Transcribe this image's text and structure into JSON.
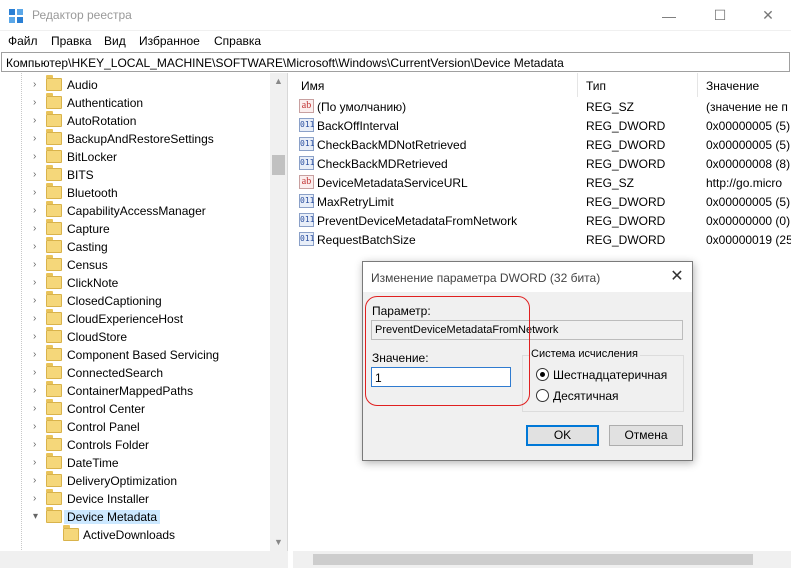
{
  "window": {
    "title": "Редактор реестра",
    "minimize": "—",
    "maximize": "☐",
    "close": "✕"
  },
  "menu": [
    "Файл",
    "Правка",
    "Вид",
    "Избранное",
    "Справка"
  ],
  "address": "Компьютер\\HKEY_LOCAL_MACHINE\\SOFTWARE\\Microsoft\\Windows\\CurrentVersion\\Device Metadata",
  "tree": {
    "items": [
      {
        "label": "Audio"
      },
      {
        "label": "Authentication"
      },
      {
        "label": "AutoRotation"
      },
      {
        "label": "BackupAndRestoreSettings"
      },
      {
        "label": "BitLocker"
      },
      {
        "label": "BITS"
      },
      {
        "label": "Bluetooth"
      },
      {
        "label": "CapabilityAccessManager"
      },
      {
        "label": "Capture"
      },
      {
        "label": "Casting"
      },
      {
        "label": "Census"
      },
      {
        "label": "ClickNote"
      },
      {
        "label": "ClosedCaptioning"
      },
      {
        "label": "CloudExperienceHost"
      },
      {
        "label": "CloudStore"
      },
      {
        "label": "Component Based Servicing"
      },
      {
        "label": "ConnectedSearch"
      },
      {
        "label": "ContainerMappedPaths"
      },
      {
        "label": "Control Center"
      },
      {
        "label": "Control Panel"
      },
      {
        "label": "Controls Folder"
      },
      {
        "label": "DateTime"
      },
      {
        "label": "DeliveryOptimization"
      },
      {
        "label": "Device Installer"
      },
      {
        "label": "Device Metadata"
      },
      {
        "label": "ActiveDownloads"
      }
    ]
  },
  "list": {
    "headers": {
      "name": "Имя",
      "type": "Тип",
      "value": "Значение"
    },
    "rows": [
      {
        "name": "(По умолчанию)",
        "type": "REG_SZ",
        "value": "(значение не п",
        "kind": "sz"
      },
      {
        "name": "BackOffInterval",
        "type": "REG_DWORD",
        "value": "0x00000005 (5)",
        "kind": "dword"
      },
      {
        "name": "CheckBackMDNotRetrieved",
        "type": "REG_DWORD",
        "value": "0x00000005 (5)",
        "kind": "dword"
      },
      {
        "name": "CheckBackMDRetrieved",
        "type": "REG_DWORD",
        "value": "0x00000008 (8)",
        "kind": "dword"
      },
      {
        "name": "DeviceMetadataServiceURL",
        "type": "REG_SZ",
        "value": "http://go.micro",
        "kind": "sz"
      },
      {
        "name": "MaxRetryLimit",
        "type": "REG_DWORD",
        "value": "0x00000005 (5)",
        "kind": "dword"
      },
      {
        "name": "PreventDeviceMetadataFromNetwork",
        "type": "REG_DWORD",
        "value": "0x00000000 (0)",
        "kind": "dword"
      },
      {
        "name": "RequestBatchSize",
        "type": "REG_DWORD",
        "value": "0x00000019 (25)",
        "kind": "dword"
      }
    ]
  },
  "dialog": {
    "title": "Изменение параметра DWORD (32 бита)",
    "param_label": "Параметр:",
    "param_value": "PreventDeviceMetadataFromNetwork",
    "value_label": "Значение:",
    "value": "1",
    "base_label": "Система исчисления",
    "hex_label": "Шестнадцатеричная",
    "dec_label": "Десятичная",
    "selected_base": "hex",
    "ok": "OK",
    "cancel": "Отмена"
  },
  "colors": {
    "accent": "#0078d7",
    "selection": "#cce8ff",
    "annotation": "#e02020"
  }
}
